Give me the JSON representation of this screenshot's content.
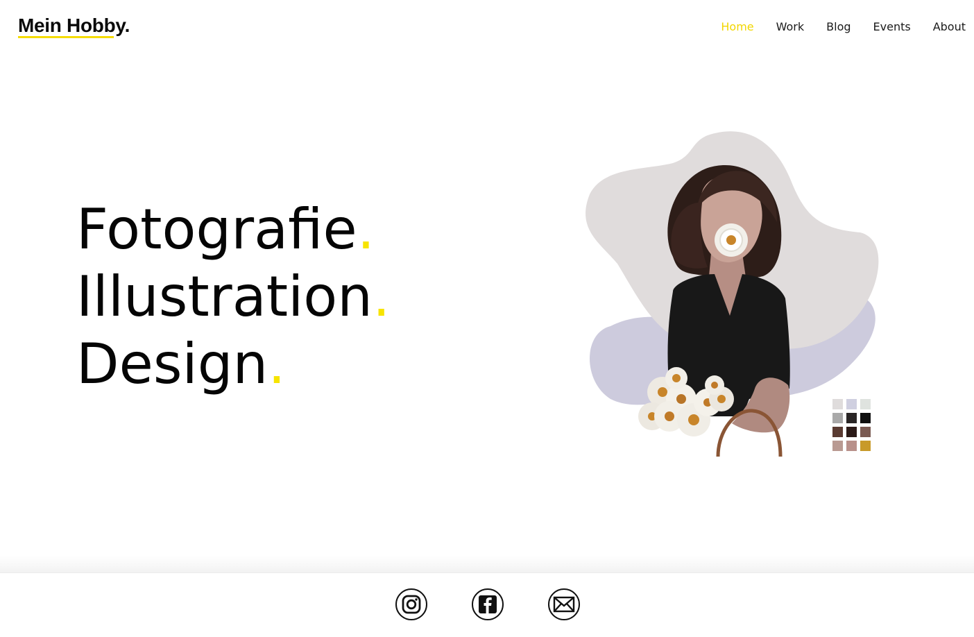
{
  "header": {
    "logo": "Mein Hobby.",
    "nav": [
      {
        "label": "Home",
        "active": true
      },
      {
        "label": "Work",
        "active": false
      },
      {
        "label": "Blog",
        "active": false
      },
      {
        "label": "Events",
        "active": false
      },
      {
        "label": "About",
        "active": false
      }
    ]
  },
  "hero": {
    "lines": [
      {
        "word": "Fotografie",
        "dot": "."
      },
      {
        "word": "Illustration",
        "dot": "."
      },
      {
        "word": "Design",
        "dot": "."
      }
    ]
  },
  "illustration": {
    "icon": "woman-with-daisies-illustration",
    "palette": [
      "#dfdcdc",
      "#cfcfe0",
      "#dfe3df",
      "#a9a9a9",
      "#2a2626",
      "#0f0f0f",
      "#5a3b32",
      "#2b1a17",
      "#7a5a52",
      "#b99a92",
      "#b8908a",
      "#c89a2a"
    ]
  },
  "footer": {
    "social": [
      {
        "icon": "instagram-icon"
      },
      {
        "icon": "facebook-icon"
      },
      {
        "icon": "mail-icon"
      }
    ]
  },
  "colors": {
    "accent": "#f7e400",
    "text": "#050505",
    "background": "#ffffff"
  }
}
